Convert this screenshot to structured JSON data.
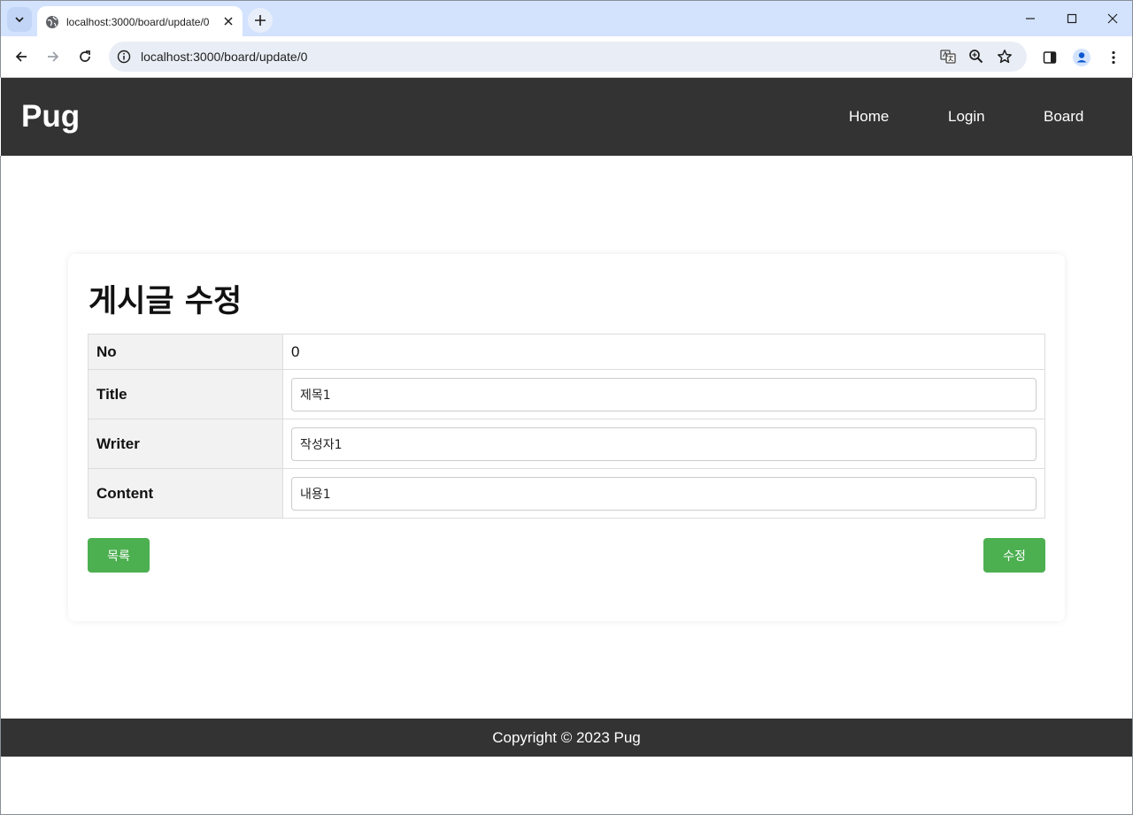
{
  "browser": {
    "tab_title": "localhost:3000/board/update/0",
    "url": "localhost:3000/board/update/0",
    "icons": [
      "tab-search-icon",
      "globe-icon",
      "close-icon",
      "plus-icon",
      "minimize-icon",
      "maximize-icon",
      "close-window-icon",
      "back-icon",
      "forward-icon",
      "reload-icon",
      "site-info-icon",
      "translate-icon",
      "zoom-icon",
      "star-icon",
      "side-panel-icon",
      "profile-icon",
      "menu-dots-icon"
    ]
  },
  "header": {
    "brand": "Pug",
    "nav": {
      "home": "Home",
      "login": "Login",
      "board": "Board"
    }
  },
  "form": {
    "title": "게시글 수정",
    "no_label": "No",
    "no_value": "0",
    "title_label": "Title",
    "title_value": "제목1",
    "writer_label": "Writer",
    "writer_value": "작성자1",
    "content_label": "Content",
    "content_value": "내용1",
    "list_button": "목록",
    "submit_button": "수정"
  },
  "footer": {
    "text": "Copyright © 2023 Pug"
  },
  "colors": {
    "header_bg": "#333333",
    "button_bg": "#4caf50",
    "tabstrip_bg": "#d3e3fd"
  }
}
